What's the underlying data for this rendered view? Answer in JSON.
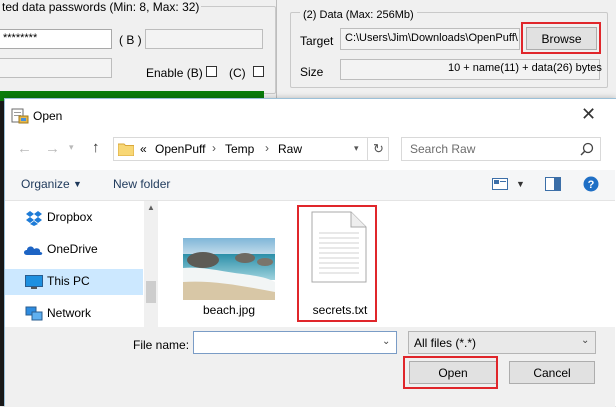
{
  "background_window": {
    "passwords_group_title": "ted data passwords (Min: 8, Max: 32)",
    "password_a_value": "********",
    "password_b_label": "( B )",
    "enable_b_label": "Enable (B)",
    "enable_c_label": "(C)",
    "data_group_title": "(2)  Data (Max: 256Mb)",
    "target_label": "Target",
    "target_value": "C:\\Users\\Jim\\Downloads\\OpenPuff\\",
    "browse_label": "Browse",
    "size_label": "Size",
    "size_value": "10 + name(11) + data(26) bytes"
  },
  "dialog": {
    "title": "Open",
    "breadcrumb": {
      "prefix": "«",
      "items": [
        "OpenPuff",
        "Temp",
        "Raw"
      ]
    },
    "search_placeholder": "Search Raw",
    "toolbar": {
      "organize_label": "Organize",
      "new_folder_label": "New folder"
    },
    "nav_items": [
      {
        "label": "Dropbox",
        "icon": "dropbox-icon"
      },
      {
        "label": "OneDrive",
        "icon": "onedrive-icon"
      },
      {
        "label": "This PC",
        "icon": "this-pc-icon",
        "selected": true
      },
      {
        "label": "Network",
        "icon": "network-icon"
      }
    ],
    "files": [
      {
        "name": "beach.jpg",
        "icon": "image-thumbnail"
      },
      {
        "name": "secrets.txt",
        "icon": "text-file-icon"
      }
    ],
    "file_name_label": "File name:",
    "file_name_value": "",
    "file_type_value": "All files (*.*)",
    "open_label": "Open",
    "cancel_label": "Cancel"
  },
  "colors": {
    "highlight_red": "#e0262b",
    "nav_selected": "#cce8ff",
    "green_bar": "#0a7d0a"
  }
}
